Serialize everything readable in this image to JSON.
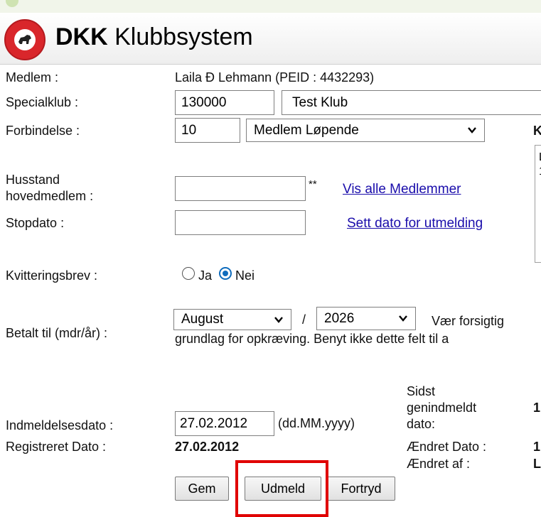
{
  "app": {
    "title_bold": "DKK",
    "title_rest": " Klubbsystem"
  },
  "member": {
    "label": "Medlem :",
    "value": "Laila Ð Lehmann  (PEID : 4432293)"
  },
  "specialklub": {
    "label": "Specialklub :",
    "code": "130000",
    "name": "Test Klub"
  },
  "forbindelse": {
    "label": "Forbindelse :",
    "code": "10",
    "selected": "Medlem Løpende",
    "side_label_partial": "K"
  },
  "side_box": {
    "line1": "L",
    "line2": "1"
  },
  "husstand": {
    "label_line1": "Husstand",
    "label_line2": "hovedmedlem :",
    "value": "",
    "marker": "**",
    "link": "Vis alle Medlemmer"
  },
  "stopdato": {
    "label": "Stopdato :",
    "value": "",
    "link": "Sett dato for utmelding"
  },
  "kvittering": {
    "label": "Kvitteringsbrev :",
    "options": [
      "Ja",
      "Nei"
    ],
    "selected": "Nei"
  },
  "betalt": {
    "label": "Betalt til (mdr/år) :",
    "month": "August",
    "separator": "/",
    "year": "2026",
    "warning_line1": "Vær forsigtig",
    "warning_line2": "grundlag for opkræving. Benyt ikke dette felt til a"
  },
  "indmeldelse": {
    "label": "Indmeldelsesdato :",
    "value": "27.02.2012",
    "format": "(dd.MM.yyyy)",
    "sidst_line1": "Sidst",
    "sidst_line2": "genindmeldt",
    "sidst_line3": "dato:",
    "sidst_value_partial": "1"
  },
  "registreret": {
    "label": "Registreret Dato :",
    "value": "27.02.2012",
    "aendret_dato_label": "Ændret Dato :",
    "aendret_dato_partial": "1",
    "aendret_af_label": "Ændret af :",
    "aendret_af_partial": "L"
  },
  "buttons": {
    "gem": "Gem",
    "udmeld": "Udmeld",
    "fortryd": "Fortryd"
  },
  "colors": {
    "link": "#1a0dab",
    "radio_checked": "#0f6cbd",
    "highlight": "#e00000",
    "logo": "#d9262b"
  }
}
